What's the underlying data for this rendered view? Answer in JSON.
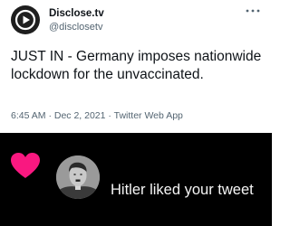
{
  "tweet": {
    "author_name": "Disclose.tv",
    "author_handle": "@disclosetv",
    "more_icon": "more-horizontal-icon",
    "text_lead": "JUST IN",
    "text_body": " - Germany imposes nationwide lockdown for the unvaccinated.",
    "timestamp": "6:45 AM · Dec 2, 2021 · Twitter Web App"
  },
  "notification": {
    "icon": "heart-icon",
    "heart_color": "#f91880",
    "message": "Hitler liked your tweet"
  },
  "colors": {
    "text_primary": "#0f1419",
    "text_secondary": "#536471",
    "notification_bg": "#000000"
  }
}
